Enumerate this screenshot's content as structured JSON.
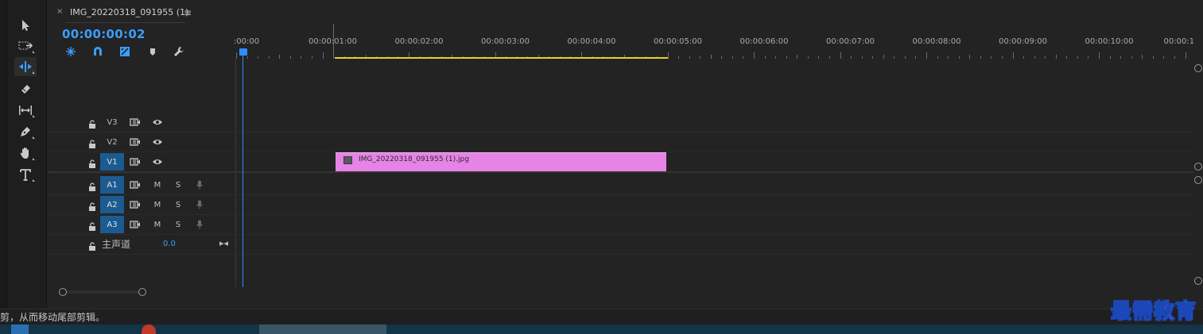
{
  "sequence": {
    "tab_title": "IMG_20220318_091955 (1)",
    "close_glyph": "×",
    "menu_glyph": "≡",
    "timecode": "00:00:00:02"
  },
  "ruler": {
    "labels": [
      ":00:00",
      "00:00:01:00",
      "00:00:02:00",
      "00:00:03:00",
      "00:00:04:00",
      "00:00:05:00",
      "00:00:06:00",
      "00:00:07:00",
      "00:00:08:00",
      "00:00:09:00",
      "00:00:10:00",
      "00:00:1"
    ]
  },
  "tools": [
    "selection-tool",
    "track-select-tool",
    "ripple-edit-tool",
    "razor-tool",
    "slip-tool",
    "pen-tool",
    "hand-tool",
    "type-tool"
  ],
  "tracks": {
    "video": [
      {
        "name": "V3",
        "selected": false
      },
      {
        "name": "V2",
        "selected": false
      },
      {
        "name": "V1",
        "selected": true
      }
    ],
    "audio": [
      {
        "name": "A1",
        "mute": "M",
        "solo": "S"
      },
      {
        "name": "A2",
        "mute": "M",
        "solo": "S"
      },
      {
        "name": "A3",
        "mute": "M",
        "solo": "S"
      }
    ],
    "master": {
      "label": "主声道",
      "value": "0.0",
      "glyph": "▸◂"
    }
  },
  "clip": {
    "label": "IMG_20220318_091955 (1).jpg",
    "color": "#e683e6"
  },
  "status": {
    "text": "剪，从而移动尾部剪辑。"
  },
  "watermark": {
    "text": "最需教育"
  },
  "colors": {
    "accent": "#3a9eff",
    "work_area": "#e6d22a",
    "track_selected": "#1b5b91"
  }
}
